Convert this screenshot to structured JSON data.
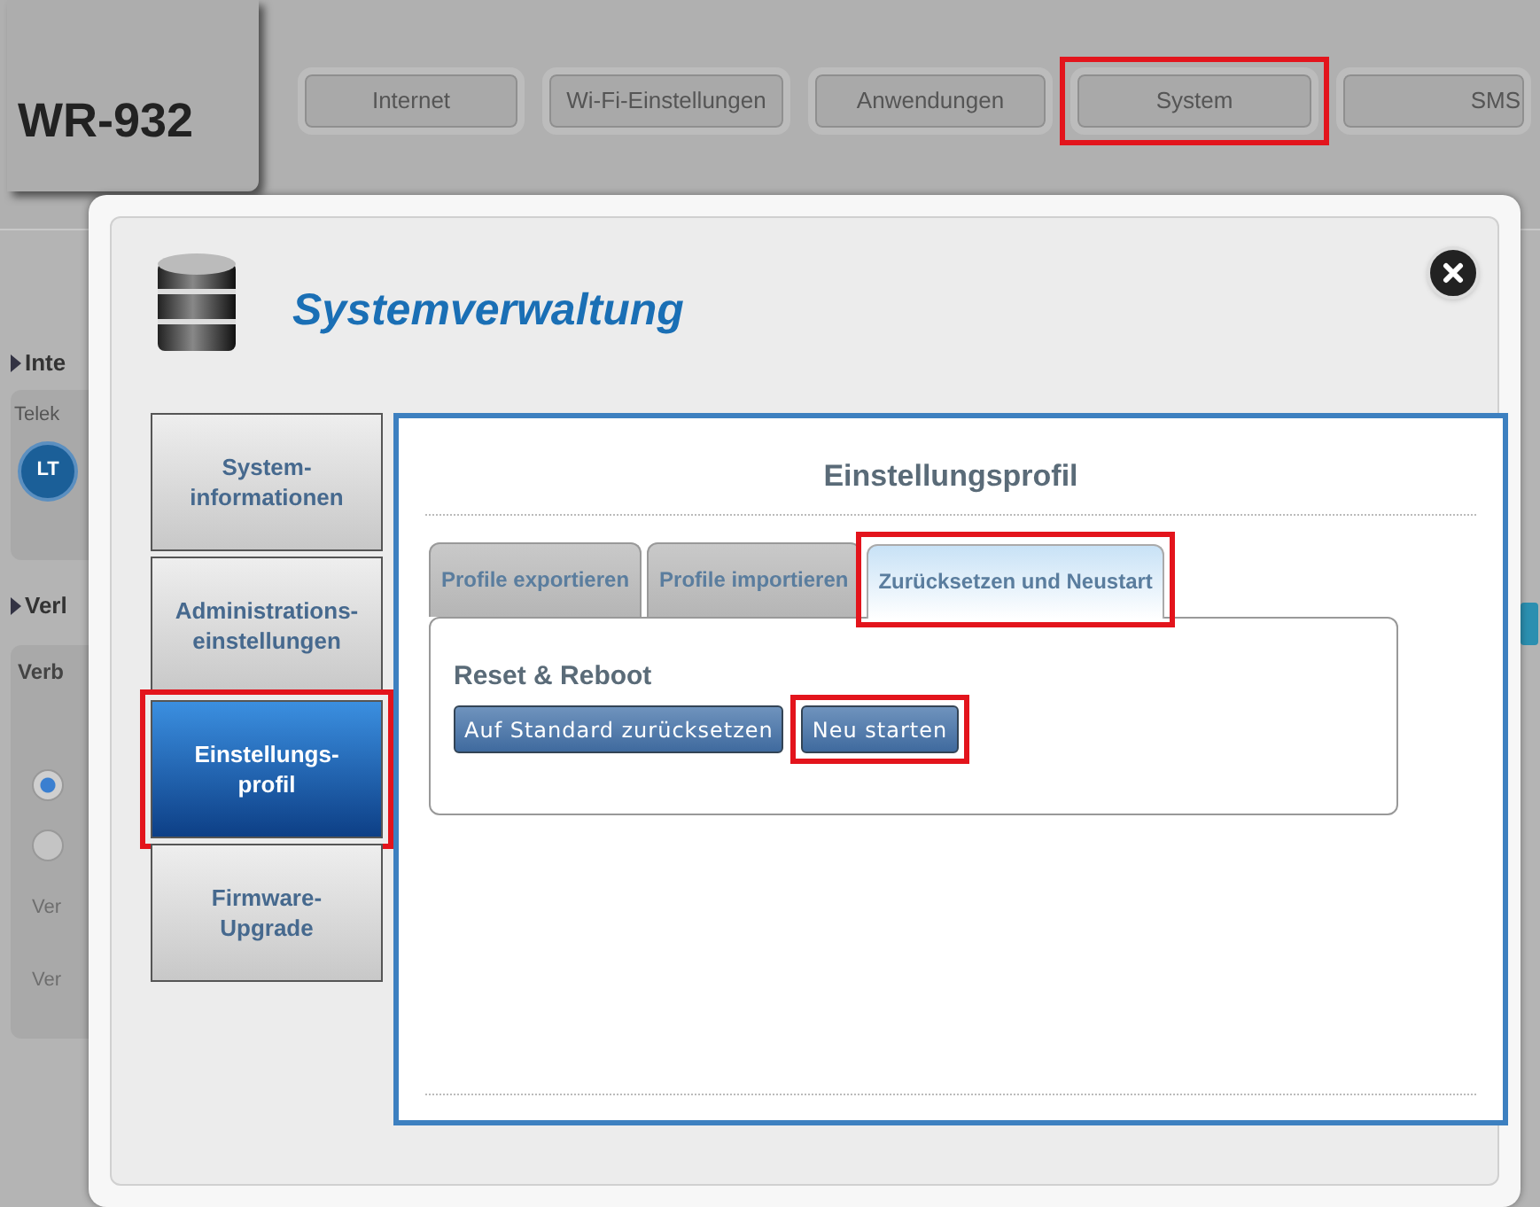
{
  "model": "WR-932",
  "nav": [
    {
      "label": "Internet",
      "highlighted": false
    },
    {
      "label": "Wi-Fi-Einstellungen",
      "highlighted": false
    },
    {
      "label": "Anwendungen",
      "highlighted": false
    },
    {
      "label": "System",
      "highlighted": true
    },
    {
      "label": "SMS",
      "highlighted": false
    }
  ],
  "background_left": {
    "section_1": "Inte",
    "provider": "Telek",
    "badge": "LT",
    "section_2": "Verl",
    "label": "Verb",
    "radios": [
      {
        "selected": true
      },
      {
        "selected": false
      }
    ],
    "rows": [
      "Ver",
      "Ver"
    ]
  },
  "dialog": {
    "title": "Systemverwaltung",
    "menu": [
      {
        "label": "System-\ninformationen",
        "selected": false,
        "highlighted": false
      },
      {
        "label": "Administrations-\neinstellungen",
        "selected": false,
        "highlighted": false
      },
      {
        "label": "Einstellungs-\nprofil",
        "selected": true,
        "highlighted": true
      },
      {
        "label": "Firmware-\nUpgrade",
        "selected": false,
        "highlighted": false
      }
    ],
    "heading": "Einstellungsprofil",
    "tabs": [
      {
        "label": "Profile exportieren",
        "selected": false,
        "highlighted": false
      },
      {
        "label": "Profile importieren",
        "selected": false,
        "highlighted": false
      },
      {
        "label": "Zurücksetzen und Neustart",
        "selected": true,
        "highlighted": true
      }
    ],
    "section_title": "Reset & Reboot",
    "buttons": [
      {
        "label": "Auf Standard zurücksetzen",
        "highlighted": false
      },
      {
        "label": "Neu starten",
        "highlighted": true
      }
    ]
  }
}
